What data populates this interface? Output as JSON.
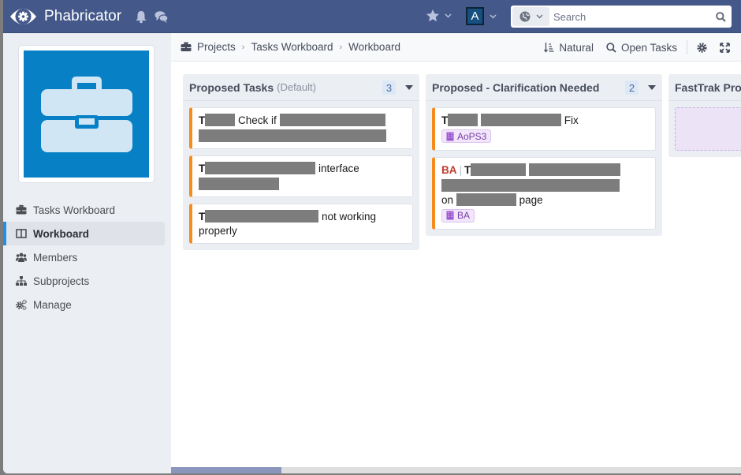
{
  "app": {
    "name": "Phabricator",
    "colors": {
      "topbar": "#44598a",
      "accent": "#1e90e6",
      "card_border": "#f58a1d",
      "profile_bg": "#0780c5",
      "tag_text": "#7a3fa8",
      "prefix_red": "#c0392b"
    }
  },
  "topbar": {
    "logo_icon": "phabricator-eye-gear-icon",
    "notifications_icon": "bell-icon",
    "messages_icon": "chat-bubbles-icon",
    "favorites_icon": "star-icon",
    "avatar_letter": "A",
    "search": {
      "scope_icon": "globe-icon",
      "placeholder": "Search",
      "value": "",
      "submit_icon": "magnifier-icon"
    }
  },
  "sidebar": {
    "profile_image_icon": "briefcase-icon",
    "items": [
      {
        "label": "Tasks Workboard",
        "icon": "briefcase-icon",
        "active": false
      },
      {
        "label": "Workboard",
        "icon": "columns-icon",
        "active": true
      },
      {
        "label": "Members",
        "icon": "users-icon",
        "active": false
      },
      {
        "label": "Subprojects",
        "icon": "sitemap-icon",
        "active": false
      },
      {
        "label": "Manage",
        "icon": "gears-icon",
        "active": false
      }
    ]
  },
  "crumbs": {
    "items": [
      "Projects",
      "Tasks Workboard",
      "Workboard"
    ]
  },
  "actions": {
    "sort_label": "Natural",
    "filter_label": "Open Tasks",
    "settings_icon": "gear-icon",
    "fullscreen_icon": "expand-icon"
  },
  "columns": [
    {
      "title": "Proposed Tasks",
      "subtitle": "(Default)",
      "count": "3",
      "cards": [
        {
          "id_prefix": "T",
          "parts": [
            "Check if"
          ],
          "tail": ""
        },
        {
          "id_prefix": "T",
          "parts": [
            "interface"
          ],
          "tail": ""
        },
        {
          "id_prefix": "T",
          "parts": [
            "not working"
          ],
          "tail": "properly"
        }
      ]
    },
    {
      "title": "Proposed - Clarification Needed",
      "count": "2",
      "cards": [
        {
          "id_prefix": "T",
          "parts": [
            "Fix"
          ],
          "tag": "AoPS3"
        },
        {
          "prefix": "BA",
          "id_prefix": "T",
          "parts": [
            "on",
            "page"
          ],
          "tag": "BA"
        }
      ]
    },
    {
      "title": "FastTrak Prop",
      "count": "",
      "cards": []
    }
  ]
}
